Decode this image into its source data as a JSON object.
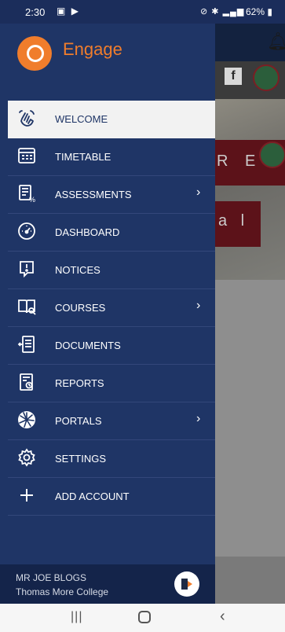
{
  "status_bar": {
    "time": "2:30",
    "left_icons": [
      "gallery-icon",
      "play-icon"
    ],
    "battery_text": "62%"
  },
  "drawer": {
    "app_name": "Engage",
    "items": [
      {
        "label": "WELCOME",
        "icon": "wave-hand-icon",
        "active": true,
        "has_chevron": false
      },
      {
        "label": "TIMETABLE",
        "icon": "timetable-icon",
        "active": false,
        "has_chevron": false
      },
      {
        "label": "ASSESSMENTS",
        "icon": "assessments-icon",
        "active": false,
        "has_chevron": true
      },
      {
        "label": "DASHBOARD",
        "icon": "dashboard-gauge-icon",
        "active": false,
        "has_chevron": false
      },
      {
        "label": "NOTICES",
        "icon": "notice-icon",
        "active": false,
        "has_chevron": false
      },
      {
        "label": "COURSES",
        "icon": "book-icon",
        "active": false,
        "has_chevron": true
      },
      {
        "label": "DOCUMENTS",
        "icon": "documents-icon",
        "active": false,
        "has_chevron": false
      },
      {
        "label": "REPORTS",
        "icon": "reports-icon",
        "active": false,
        "has_chevron": false
      },
      {
        "label": "PORTALS",
        "icon": "portal-icon",
        "active": false,
        "has_chevron": true
      },
      {
        "label": "SETTINGS",
        "icon": "gear-icon",
        "active": false,
        "has_chevron": false
      },
      {
        "label": "ADD ACCOUNT",
        "icon": "plus-icon",
        "active": false,
        "has_chevron": false
      }
    ],
    "footer": {
      "user_name": "MR JOE BLOGS",
      "school": "Thomas More College"
    }
  },
  "background": {
    "banner1_text": "R E",
    "banner2_text": "a l"
  },
  "colors": {
    "drawer_bg": "#1f3566",
    "accent": "#f07d2c",
    "active_item_bg": "#f2f2f2"
  }
}
